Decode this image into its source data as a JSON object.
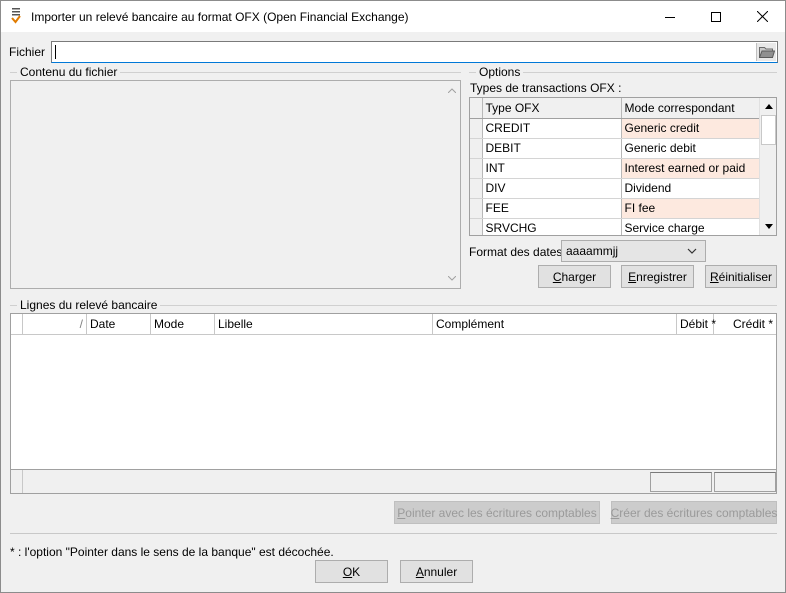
{
  "window": {
    "title": "Importer un relevé bancaire au format OFX (Open Financial Exchange)"
  },
  "file": {
    "label": "Fichier",
    "value": ""
  },
  "content": {
    "group_title": "Contenu du fichier"
  },
  "options": {
    "group_title": "Options",
    "transactions_label": "Types de transactions OFX :",
    "grid": {
      "columns": [
        "Type OFX",
        "Mode correspondant"
      ],
      "rows": [
        {
          "type": "CREDIT",
          "mode": "Generic credit",
          "highlight": true
        },
        {
          "type": "DEBIT",
          "mode": "Generic debit",
          "highlight": false
        },
        {
          "type": "INT",
          "mode": "Interest earned or paid",
          "highlight": true
        },
        {
          "type": "DIV",
          "mode": "Dividend",
          "highlight": false
        },
        {
          "type": "FEE",
          "mode": "FI fee",
          "highlight": true
        },
        {
          "type": "SRVCHG",
          "mode": "Service charge",
          "highlight": false
        }
      ]
    },
    "date_format_label": "Format des dates",
    "date_format_value": "aaaammjj",
    "buttons": {
      "load": "Charger",
      "save": "Enregistrer",
      "reset": "Réinitialiser"
    }
  },
  "lines": {
    "group_title": "Lignes du relevé bancaire",
    "columns": {
      "sort": "/",
      "date": "Date",
      "mode": "Mode",
      "libelle": "Libelle",
      "complement": "Complément",
      "debit": "Débit *",
      "credit": "Crédit *"
    }
  },
  "actions": {
    "point": "Pointer avec les écritures comptables",
    "create": "Créer des écritures comptables"
  },
  "note": "* : l'option \"Pointer dans le sens de la banque\" est décochée.",
  "footer": {
    "ok": "OK",
    "cancel": "Annuler"
  }
}
